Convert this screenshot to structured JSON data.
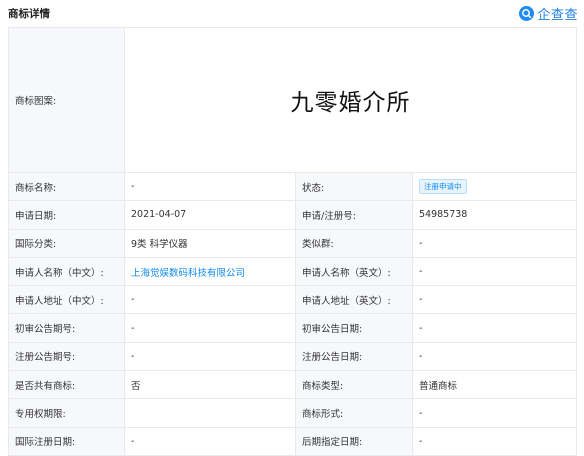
{
  "header": {
    "title": "商标详情",
    "brand": "企查查",
    "brand_color": "#1f8bf0"
  },
  "trademark": {
    "image_label": "商标图案:",
    "image_text": "九零婚介所",
    "rows": [
      {
        "l1": "商标名称:",
        "v1": "-",
        "l2": "状态:",
        "v2": "注册申请中"
      },
      {
        "l1": "申请日期:",
        "v1": "2021-04-07",
        "l2": "申请/注册号:",
        "v2": "54985738"
      },
      {
        "l1": "国际分类:",
        "v1": "9类 科学仪器",
        "l2": "类似群:",
        "v2": "-"
      },
      {
        "l1": "申请人名称（中文）:",
        "v1": "上海觉娱数码科技有限公司",
        "l2": "申请人名称（英文）:",
        "v2": "-"
      },
      {
        "l1": "申请人地址（中文）:",
        "v1": "-",
        "l2": "申请人地址（英文）:",
        "v2": "-"
      },
      {
        "l1": "初审公告期号:",
        "v1": "-",
        "l2": "初审公告日期:",
        "v2": "-"
      },
      {
        "l1": "注册公告期号:",
        "v1": "-",
        "l2": "注册公告日期:",
        "v2": "-"
      },
      {
        "l1": "是否共有商标:",
        "v1": "否",
        "l2": "商标类型:",
        "v2": "普通商标"
      },
      {
        "l1": "专用权期限:",
        "v1": "",
        "l2": "商标形式:",
        "v2": "-"
      },
      {
        "l1": "国际注册日期:",
        "v1": "-",
        "l2": "后期指定日期:",
        "v2": "-"
      }
    ]
  },
  "colors": {
    "link": "#128bed",
    "label_bg": "#f6f8fb",
    "status_badge": "#128bed"
  }
}
